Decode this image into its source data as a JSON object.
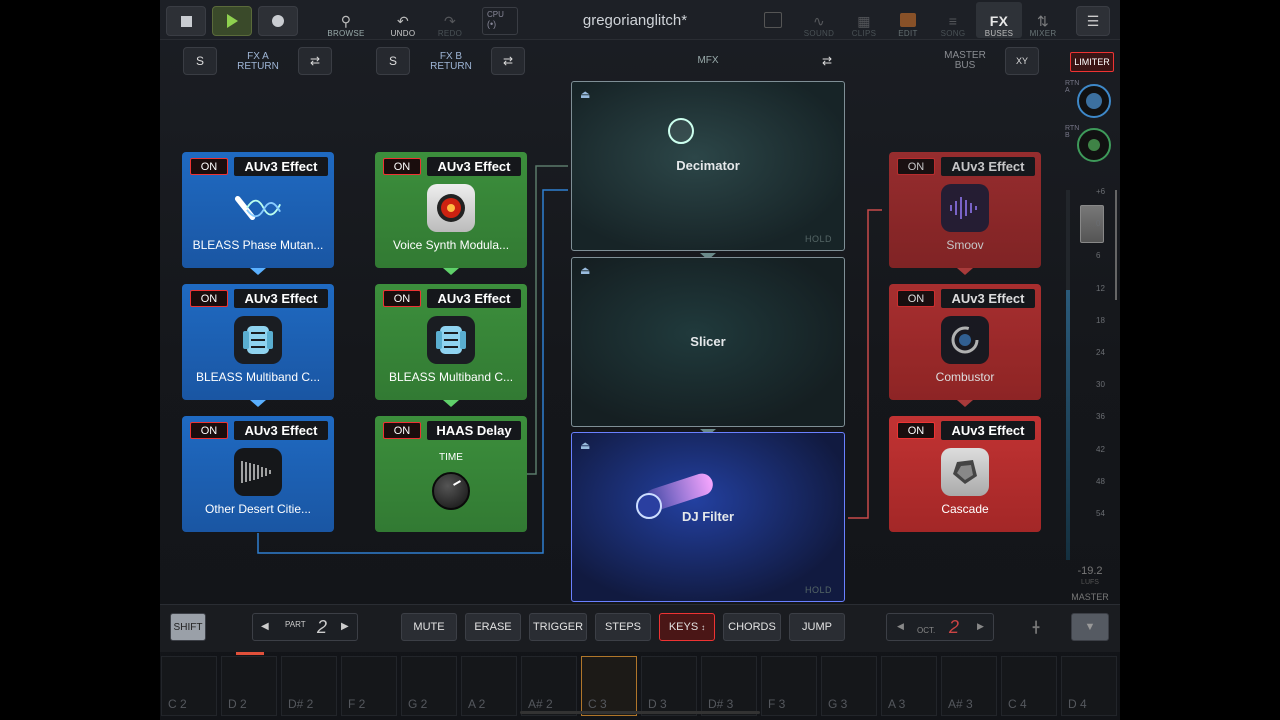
{
  "topbar": {
    "title": "gregorianglitch*",
    "tools": {
      "browse": "BROWSE",
      "undo": "UNDO",
      "redo": "REDO",
      "cpu": "CPU",
      "sound": "SOUND",
      "clips": "CLIPS",
      "edit": "EDIT",
      "song": "SONG",
      "fx": "FX",
      "buses": "BUSES",
      "mixer": "MIXER"
    }
  },
  "bus_header": {
    "s_label": "S",
    "fxa_line1": "FX A",
    "fxa_line2": "RETURN",
    "fxb_line1": "FX B",
    "fxb_line2": "RETURN",
    "mfx": "MFX",
    "master_line1": "MASTER",
    "master_line2": "BUS",
    "xy": "XY",
    "limiter": "LIMITER"
  },
  "fx_a": [
    {
      "on": "ON",
      "type": "AUv3 Effect",
      "name": "BLEASS Phase Mutan..."
    },
    {
      "on": "ON",
      "type": "AUv3 Effect",
      "name": "BLEASS Multiband C..."
    },
    {
      "on": "ON",
      "type": "AUv3 Effect",
      "name": "Other Desert Citie..."
    }
  ],
  "fx_b": [
    {
      "on": "ON",
      "type": "AUv3 Effect",
      "name": "Voice Synth Modula..."
    },
    {
      "on": "ON",
      "type": "AUv3 Effect",
      "name": "BLEASS Multiband C..."
    },
    {
      "on": "ON",
      "type": "HAAS Delay",
      "knob_label": "TIME"
    }
  ],
  "mfx": [
    {
      "name": "Decimator",
      "hold": "HOLD"
    },
    {
      "name": "Slicer"
    },
    {
      "name": "DJ Filter",
      "hold": "HOLD"
    }
  ],
  "master": [
    {
      "on": "ON",
      "type": "AUv3 Effect",
      "name": "Smoov"
    },
    {
      "on": "ON",
      "type": "AUv3 Effect",
      "name": "Combustor"
    },
    {
      "on": "ON",
      "type": "AUv3 Effect",
      "name": "Cascade"
    }
  ],
  "meter": {
    "rtn_a": "RTN A",
    "rtn_b": "RTN B",
    "ticks": [
      "+6",
      "0",
      "6",
      "12",
      "18",
      "24",
      "30",
      "36",
      "42",
      "48",
      "54"
    ],
    "lufs_value": "-19.2",
    "lufs_label": "LUFS",
    "master_label": "MASTER"
  },
  "bottom": {
    "shift": "SHIFT",
    "part_label": "PART",
    "part_value": "2",
    "modes": [
      "MUTE",
      "ERASE",
      "TRIGGER",
      "STEPS",
      "KEYS",
      "CHORDS",
      "JUMP"
    ],
    "oct_label": "OCT.",
    "oct_value": "2"
  },
  "keys": [
    "C 2",
    "D 2",
    "D# 2",
    "F 2",
    "G 2",
    "A 2",
    "A# 2",
    "C 3",
    "D 3",
    "D# 3",
    "F 3",
    "G 3",
    "A 3",
    "A# 3",
    "C 4",
    "D 4"
  ]
}
